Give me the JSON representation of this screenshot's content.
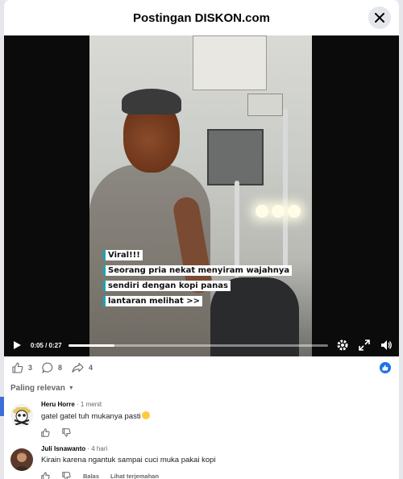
{
  "header": {
    "title": "Postingan DISKON.com"
  },
  "video": {
    "caption_lines": [
      "Viral!!!",
      "Seorang pria nekat menyiram wajahnya",
      "sendiri dengan kopi panas",
      "lantaran melihat >>"
    ],
    "time_display": "0:05 / 0:27",
    "progress_fraction": 0.18
  },
  "reactions": {
    "likes": "3",
    "comments": "8",
    "shares": "4"
  },
  "sort": {
    "label": "Paling relevan"
  },
  "comments": [
    {
      "name": "Heru Horre",
      "time": "1 menit",
      "text": "gatel gatel tuh mukanya pasti",
      "actions": []
    },
    {
      "name": "Juli Isnawanto",
      "time": "4 hari",
      "text": "Kirain karena ngantuk sampai cuci muka pakai kopi",
      "actions": [
        "Balas",
        "Lihat terjemahan"
      ]
    }
  ],
  "icons": {
    "close": "close-icon",
    "play": "play-icon",
    "settings": "gear-icon",
    "fullscreen": "fullscreen-icon",
    "volume": "volume-icon",
    "like": "thumbs-up-icon",
    "comment": "comment-icon",
    "share": "share-icon",
    "dislike": "thumbs-down-icon"
  },
  "colors": {
    "accent": "#1b74e4",
    "caption_border": "#1aa6b7"
  }
}
